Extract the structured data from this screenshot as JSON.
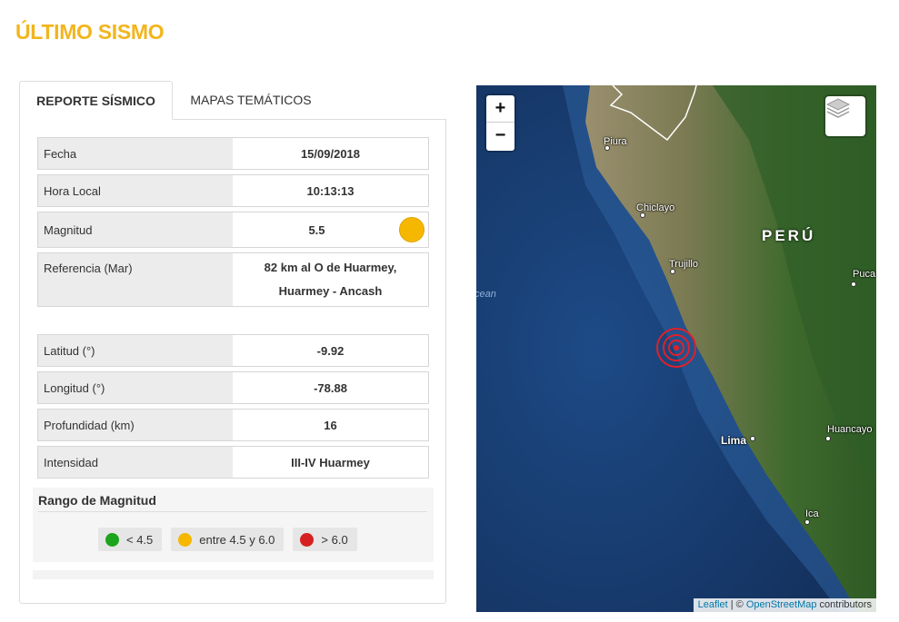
{
  "page": {
    "title": "ÚLTIMO SISMO"
  },
  "tabs": [
    {
      "label": "REPORTE SÍSMICO",
      "active": true
    },
    {
      "label": "MAPAS TEMÁTICOS",
      "active": false
    }
  ],
  "report": {
    "fecha": {
      "label": "Fecha",
      "value": "15/09/2018"
    },
    "hora": {
      "label": "Hora Local",
      "value": "10:13:13"
    },
    "magnitud": {
      "label": "Magnitud",
      "value": "5.5",
      "color": "#f5b700"
    },
    "referencia": {
      "label": "Referencia (Mar)",
      "line1": "82 km al O de Huarmey,",
      "line2": "Huarmey - Ancash"
    },
    "latitud": {
      "label": "Latitud (°)",
      "value": "-9.92"
    },
    "longitud": {
      "label": "Longitud (°)",
      "value": "-78.88"
    },
    "profundidad": {
      "label": "Profundidad (km)",
      "value": "16"
    },
    "intensidad": {
      "label": "Intensidad",
      "value": "III-IV Huarmey"
    }
  },
  "range": {
    "title": "Rango de Magnitud",
    "items": [
      {
        "label": "< 4.5",
        "color": "#1ca51c"
      },
      {
        "label": "entre 4.5 y 6.0",
        "color": "#f5b700"
      },
      {
        "label": "> 6.0",
        "color": "#d62020"
      }
    ]
  },
  "map": {
    "zoom_in": "+",
    "zoom_out": "−",
    "country": "PERÚ",
    "ocean": "cean",
    "cities": [
      "Piura",
      "Chiclayo",
      "Trujillo",
      "Lima",
      "Huancayo",
      "Ica",
      "Puca"
    ],
    "attribution": {
      "leaflet": "Leaflet",
      "sep": " | © ",
      "osm": "OpenStreetMap",
      "suffix": " contributors"
    },
    "epicenter_color": "#e0202a"
  }
}
